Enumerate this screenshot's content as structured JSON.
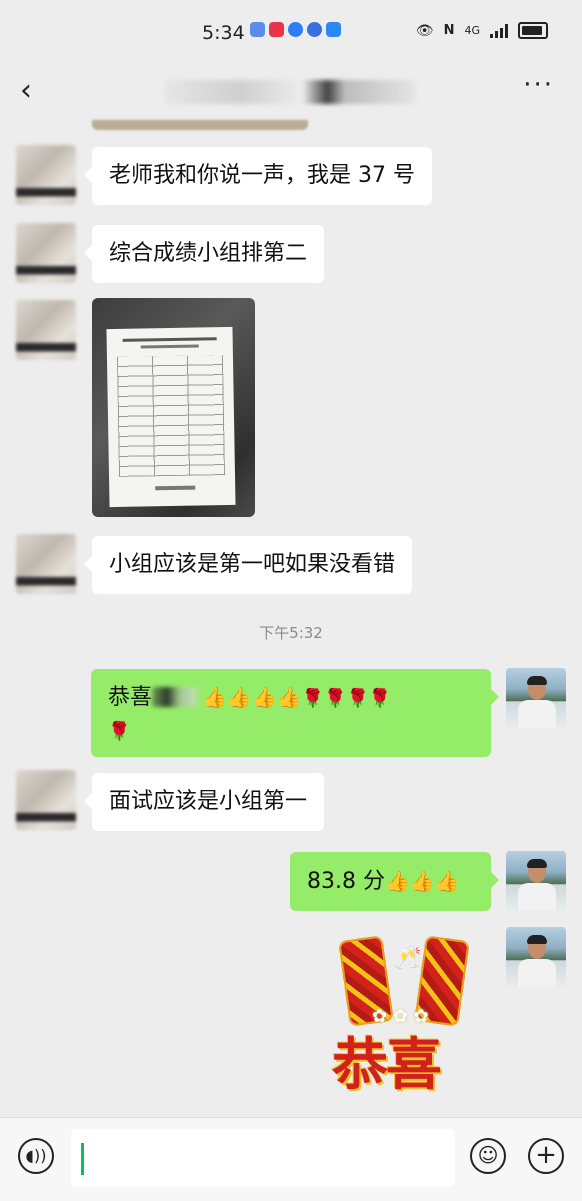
{
  "status_bar": {
    "time": "5:34",
    "network": "4G",
    "app_icons": [
      "music-app-icon",
      "mobile-app-icon",
      "browser-app-icon",
      "paw-app-icon",
      "cloud-app-icon"
    ]
  },
  "nav": {
    "back_label": "‹",
    "more_label": "···"
  },
  "messages": [
    {
      "side": "in",
      "text": "老师我和你说一声，我是 37 号"
    },
    {
      "side": "in",
      "text": "综合成绩小组排第二"
    },
    {
      "side": "in",
      "type": "image"
    },
    {
      "side": "in",
      "text": "小组应该是第一吧如果没看错"
    },
    {
      "side": "out",
      "text_prefix": "恭喜",
      "thumbs": "👍👍👍👍",
      "roses": "🌹🌹🌹🌹",
      "rose_line2": "🌹"
    },
    {
      "side": "in",
      "text": "面试应该是小组第一"
    },
    {
      "side": "out",
      "text": "83.8 分",
      "thumbs": "👍👍👍"
    },
    {
      "side": "out",
      "type": "sticker",
      "caption": "恭喜"
    }
  ],
  "timestamp": "下午5:32",
  "input": {
    "value": ""
  },
  "colors": {
    "incoming": "#ffffff",
    "outgoing": "#95ec69",
    "background": "#ededed",
    "caret": "#07c160"
  }
}
